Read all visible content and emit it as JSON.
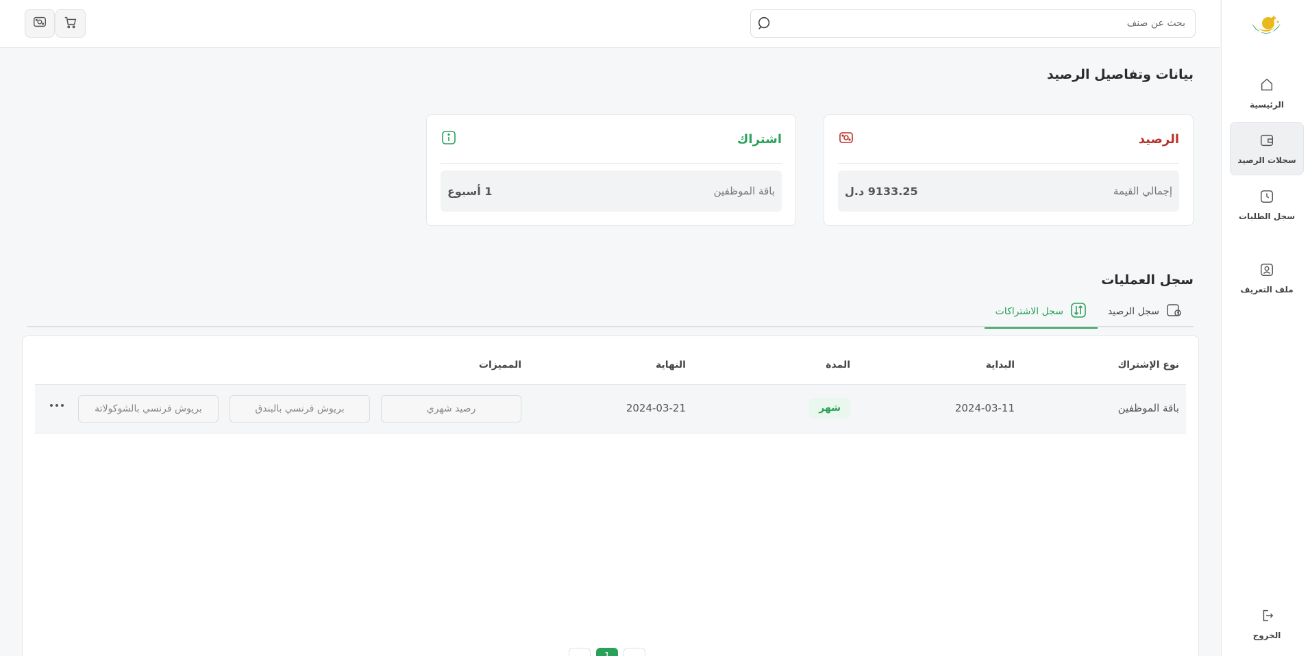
{
  "sidebar": {
    "items": [
      {
        "label": "الرئيسية",
        "icon": "home-icon"
      },
      {
        "label": "سجلات الرصيد",
        "icon": "wallet-icon"
      },
      {
        "label": "سجل الطلبات",
        "icon": "clock-icon"
      },
      {
        "label": "ملف التعريف",
        "icon": "user-icon"
      }
    ],
    "logout": {
      "label": "الخروج",
      "icon": "logout-icon"
    }
  },
  "search": {
    "placeholder": "بحث عن صنف"
  },
  "page": {
    "title": "بيانات وتفاصيل الرصيد"
  },
  "balance_card": {
    "title": "الرصيد",
    "label": "إجمالي القيمة",
    "value": "9133.25 د.ل",
    "title_color": "#b8322a"
  },
  "subscription_card": {
    "title": "اشتراك",
    "label": "باقة الموظفين",
    "value": "1 أسبوع",
    "title_color": "#2aa15a"
  },
  "operations": {
    "title": "سجل العمليات",
    "tabs": [
      {
        "label": "سجل الرصيد",
        "active": false
      },
      {
        "label": "سجل الاشتراكات",
        "active": true
      }
    ]
  },
  "table": {
    "headers": {
      "type": "نوع الإشتراك",
      "start": "البداية",
      "duration": "المدة",
      "end": "النهاية",
      "features": "المميزات"
    },
    "rows": [
      {
        "type": "باقة الموظفين",
        "start": "2024-03-11",
        "duration": "شهر",
        "end": "2024-03-21",
        "features": [
          "رصيد شهري",
          "بريوش فرنسي بالبندق",
          "بريوش فرنسي بالشوكولاتة"
        ]
      }
    ]
  },
  "pagination": {
    "current": "1"
  },
  "colors": {
    "accent": "#2aa15a",
    "danger": "#b8322a"
  }
}
